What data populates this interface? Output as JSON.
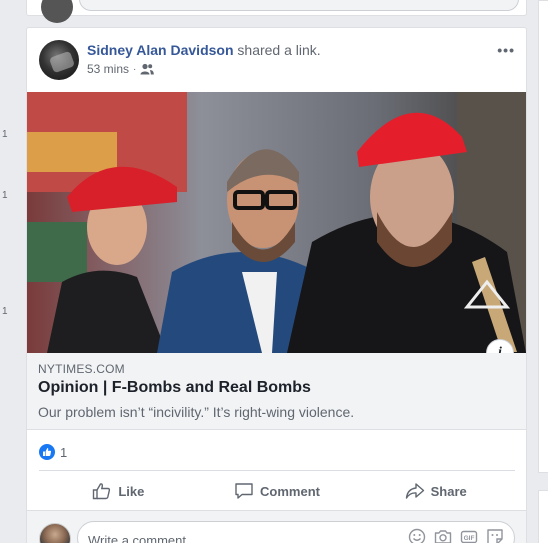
{
  "post": {
    "author": "Sidney Alan Davidson",
    "action": "shared a link.",
    "timestamp": "53 mins",
    "separator": "·",
    "audience_icon": "friends-icon",
    "more_label": "•••"
  },
  "link": {
    "domain": "NYTIMES.COM",
    "headline": "Opinion | F-Bombs and Real Bombs",
    "description": "Our problem isn’t “incivility.” It’s right-wing violence.",
    "info_label": "i"
  },
  "reactions": {
    "like_count": "1"
  },
  "actions": {
    "like": "Like",
    "comment": "Comment",
    "share": "Share"
  },
  "comment_box": {
    "placeholder": "Write a comment...",
    "icons": [
      "emoji-icon",
      "camera-icon",
      "gif-icon",
      "sticker-icon"
    ]
  },
  "side_marks": [
    "1",
    "1",
    "1"
  ],
  "colors": {
    "link_blue": "#365899",
    "like_blue": "#1877f2",
    "background": "#e9ebee"
  }
}
